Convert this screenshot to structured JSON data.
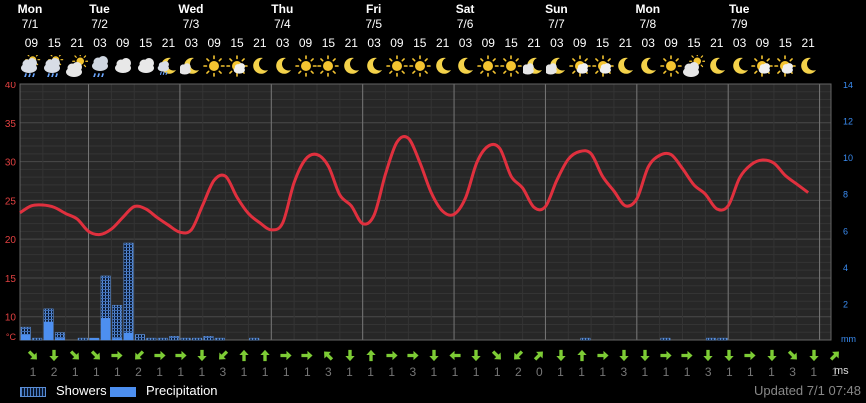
{
  "days": [
    {
      "name": "Mon",
      "date": "7/1"
    },
    {
      "name": "Tue",
      "date": "7/2"
    },
    {
      "name": "Wed",
      "date": "7/3"
    },
    {
      "name": "Thu",
      "date": "7/4"
    },
    {
      "name": "Fri",
      "date": "7/5"
    },
    {
      "name": "Sat",
      "date": "7/6"
    },
    {
      "name": "Sun",
      "date": "7/7"
    },
    {
      "name": "Mon",
      "date": "7/8"
    },
    {
      "name": "Tue",
      "date": "7/9"
    }
  ],
  "slots": [
    {
      "hour": "09",
      "icon": "rain-cloud-sun-icon"
    },
    {
      "hour": "15",
      "icon": "rain-cloud-sun-icon"
    },
    {
      "hour": "21",
      "icon": "partly-cloudy-sun-icon"
    },
    {
      "hour": "03",
      "icon": "rain-cloud-icon"
    },
    {
      "hour": "09",
      "icon": "cloud-icon"
    },
    {
      "hour": "15",
      "icon": "cloud-icon"
    },
    {
      "hour": "21",
      "icon": "moon-rain-icon"
    },
    {
      "hour": "03",
      "icon": "moon-cloud-icon"
    },
    {
      "hour": "09",
      "icon": "sun-icon"
    },
    {
      "hour": "15",
      "icon": "sun-cloud-icon"
    },
    {
      "hour": "21",
      "icon": "moon-icon"
    },
    {
      "hour": "03",
      "icon": "moon-icon"
    },
    {
      "hour": "09",
      "icon": "sun-icon"
    },
    {
      "hour": "15",
      "icon": "sun-icon"
    },
    {
      "hour": "21",
      "icon": "moon-icon"
    },
    {
      "hour": "03",
      "icon": "moon-icon"
    },
    {
      "hour": "09",
      "icon": "sun-icon"
    },
    {
      "hour": "15",
      "icon": "sun-icon"
    },
    {
      "hour": "21",
      "icon": "moon-icon"
    },
    {
      "hour": "03",
      "icon": "moon-icon"
    },
    {
      "hour": "09",
      "icon": "sun-icon"
    },
    {
      "hour": "15",
      "icon": "sun-icon"
    },
    {
      "hour": "21",
      "icon": "moon-cloud-icon"
    },
    {
      "hour": "03",
      "icon": "moon-cloud-icon"
    },
    {
      "hour": "09",
      "icon": "sun-cloud-icon"
    },
    {
      "hour": "15",
      "icon": "sun-cloud-icon"
    },
    {
      "hour": "21",
      "icon": "moon-icon"
    },
    {
      "hour": "03",
      "icon": "moon-icon"
    },
    {
      "hour": "09",
      "icon": "sun-icon"
    },
    {
      "hour": "15",
      "icon": "partly-cloudy-sun-icon"
    },
    {
      "hour": "21",
      "icon": "moon-icon"
    },
    {
      "hour": "03",
      "icon": "moon-icon"
    },
    {
      "hour": "09",
      "icon": "sun-cloud-icon"
    },
    {
      "hour": "15",
      "icon": "sun-cloud-icon"
    },
    {
      "hour": "21",
      "icon": "moon-icon"
    }
  ],
  "wind": [
    {
      "dir": "se",
      "speed": "1"
    },
    {
      "dir": "s",
      "speed": "2"
    },
    {
      "dir": "se",
      "speed": "1"
    },
    {
      "dir": "se",
      "speed": "1"
    },
    {
      "dir": "e",
      "speed": "1"
    },
    {
      "dir": "sw",
      "speed": "2"
    },
    {
      "dir": "e",
      "speed": "1"
    },
    {
      "dir": "e",
      "speed": "1"
    },
    {
      "dir": "s",
      "speed": "1"
    },
    {
      "dir": "sw",
      "speed": "3"
    },
    {
      "dir": "n",
      "speed": "1"
    },
    {
      "dir": "n",
      "speed": "1"
    },
    {
      "dir": "e",
      "speed": "1"
    },
    {
      "dir": "e",
      "speed": "1"
    },
    {
      "dir": "nw",
      "speed": "3"
    },
    {
      "dir": "s",
      "speed": "1"
    },
    {
      "dir": "n",
      "speed": "1"
    },
    {
      "dir": "e",
      "speed": "1"
    },
    {
      "dir": "e",
      "speed": "3"
    },
    {
      "dir": "s",
      "speed": "1"
    },
    {
      "dir": "w",
      "speed": "1"
    },
    {
      "dir": "s",
      "speed": "1"
    },
    {
      "dir": "se",
      "speed": "1"
    },
    {
      "dir": "sw",
      "speed": "2"
    },
    {
      "dir": "ne",
      "speed": "0"
    },
    {
      "dir": "s",
      "speed": "1"
    },
    {
      "dir": "n",
      "speed": "1"
    },
    {
      "dir": "e",
      "speed": "1"
    },
    {
      "dir": "s",
      "speed": "3"
    },
    {
      "dir": "s",
      "speed": "1"
    },
    {
      "dir": "e",
      "speed": "1"
    },
    {
      "dir": "e",
      "speed": "1"
    },
    {
      "dir": "s",
      "speed": "3"
    },
    {
      "dir": "s",
      "speed": "1"
    },
    {
      "dir": "e",
      "speed": "1"
    },
    {
      "dir": "s",
      "speed": "1"
    },
    {
      "dir": "se",
      "speed": "3"
    },
    {
      "dir": "s",
      "speed": "1"
    },
    {
      "dir": "ne",
      "speed": "1"
    }
  ],
  "wind_unit": "ms",
  "legend": {
    "showers": "Showers",
    "precipitation": "Precipitation"
  },
  "updated": "Updated 7/1 07:48",
  "colors": {
    "temperature": "#e0303e",
    "precip": "#4d8ff0",
    "left_axis": "#e04040",
    "right_axis": "#3a8bf0",
    "wind_arrow": "#7dcc35"
  },
  "chart_data": {
    "type": "line",
    "x_unit": "hours from Mon 7/1 00:00",
    "xlim": [
      6,
      219
    ],
    "y_left": {
      "label": "°C",
      "ticks": [
        10,
        15,
        20,
        25,
        30,
        35,
        40
      ],
      "ylim": [
        7,
        40
      ]
    },
    "y_right": {
      "label": "mm",
      "ticks": [
        2,
        4,
        6,
        8,
        10,
        12,
        14
      ],
      "ylim": [
        0,
        14
      ]
    },
    "series": [
      {
        "kind": "temperature",
        "color": "#e0303e",
        "points": [
          [
            6,
            23.4
          ],
          [
            9,
            24.3
          ],
          [
            12,
            24.4
          ],
          [
            15,
            24.1
          ],
          [
            18,
            23.3
          ],
          [
            21,
            22.6
          ],
          [
            24,
            21.0
          ],
          [
            27,
            20.6
          ],
          [
            30,
            21.3
          ],
          [
            33,
            22.8
          ],
          [
            36,
            24.2
          ],
          [
            39,
            23.9
          ],
          [
            42,
            22.8
          ],
          [
            45,
            21.8
          ],
          [
            48,
            20.9
          ],
          [
            51,
            21.2
          ],
          [
            54,
            24.4
          ],
          [
            57,
            27.6
          ],
          [
            60,
            28.1
          ],
          [
            63,
            25.4
          ],
          [
            66,
            23.3
          ],
          [
            69,
            22.1
          ],
          [
            72,
            21.2
          ],
          [
            75,
            22.1
          ],
          [
            78,
            27.3
          ],
          [
            81,
            30.3
          ],
          [
            84,
            30.9
          ],
          [
            87,
            29.4
          ],
          [
            90,
            25.7
          ],
          [
            93,
            24.3
          ],
          [
            96,
            22.0
          ],
          [
            99,
            23.1
          ],
          [
            102,
            28.4
          ],
          [
            105,
            32.5
          ],
          [
            108,
            33.0
          ],
          [
            111,
            29.9
          ],
          [
            114,
            26.0
          ],
          [
            117,
            23.6
          ],
          [
            120,
            23.2
          ],
          [
            123,
            25.3
          ],
          [
            126,
            29.9
          ],
          [
            129,
            32.0
          ],
          [
            132,
            31.7
          ],
          [
            135,
            28.1
          ],
          [
            138,
            26.6
          ],
          [
            141,
            24.1
          ],
          [
            144,
            24.2
          ],
          [
            147,
            27.6
          ],
          [
            150,
            30.3
          ],
          [
            153,
            31.3
          ],
          [
            156,
            31.0
          ],
          [
            159,
            28.1
          ],
          [
            162,
            26.2
          ],
          [
            165,
            24.3
          ],
          [
            168,
            25.2
          ],
          [
            171,
            29.3
          ],
          [
            174,
            30.8
          ],
          [
            177,
            30.9
          ],
          [
            180,
            29.1
          ],
          [
            183,
            27.0
          ],
          [
            186,
            25.8
          ],
          [
            189,
            23.9
          ],
          [
            192,
            24.3
          ],
          [
            195,
            27.9
          ],
          [
            198,
            29.6
          ],
          [
            201,
            30.2
          ],
          [
            204,
            29.8
          ],
          [
            207,
            28.2
          ],
          [
            210,
            27.1
          ],
          [
            213,
            26.0
          ]
        ]
      },
      {
        "kind": "showers_mm",
        "bar_hours": 3,
        "values": [
          [
            6,
            0.7
          ],
          [
            9,
            0.1
          ],
          [
            12,
            1.7
          ],
          [
            15,
            0.4
          ],
          [
            21,
            0.1
          ],
          [
            24,
            0.1
          ],
          [
            27,
            3.5
          ],
          [
            30,
            1.9
          ],
          [
            33,
            5.3
          ],
          [
            36,
            0.3
          ],
          [
            39,
            0.1
          ],
          [
            42,
            0.1
          ],
          [
            45,
            0.2
          ],
          [
            48,
            0.1
          ],
          [
            51,
            0.1
          ],
          [
            54,
            0.2
          ],
          [
            57,
            0.1
          ],
          [
            66,
            0.1
          ],
          [
            153,
            0.1
          ],
          [
            174,
            0.1
          ],
          [
            186,
            0.1
          ],
          [
            189,
            0.1
          ]
        ]
      },
      {
        "kind": "precipitation_mm",
        "bar_hours": 3,
        "values": [
          [
            6,
            0.3
          ],
          [
            12,
            1.0
          ],
          [
            15,
            0.1
          ],
          [
            24,
            0.1
          ],
          [
            27,
            1.2
          ],
          [
            30,
            0.1
          ],
          [
            33,
            0.4
          ]
        ]
      }
    ]
  }
}
